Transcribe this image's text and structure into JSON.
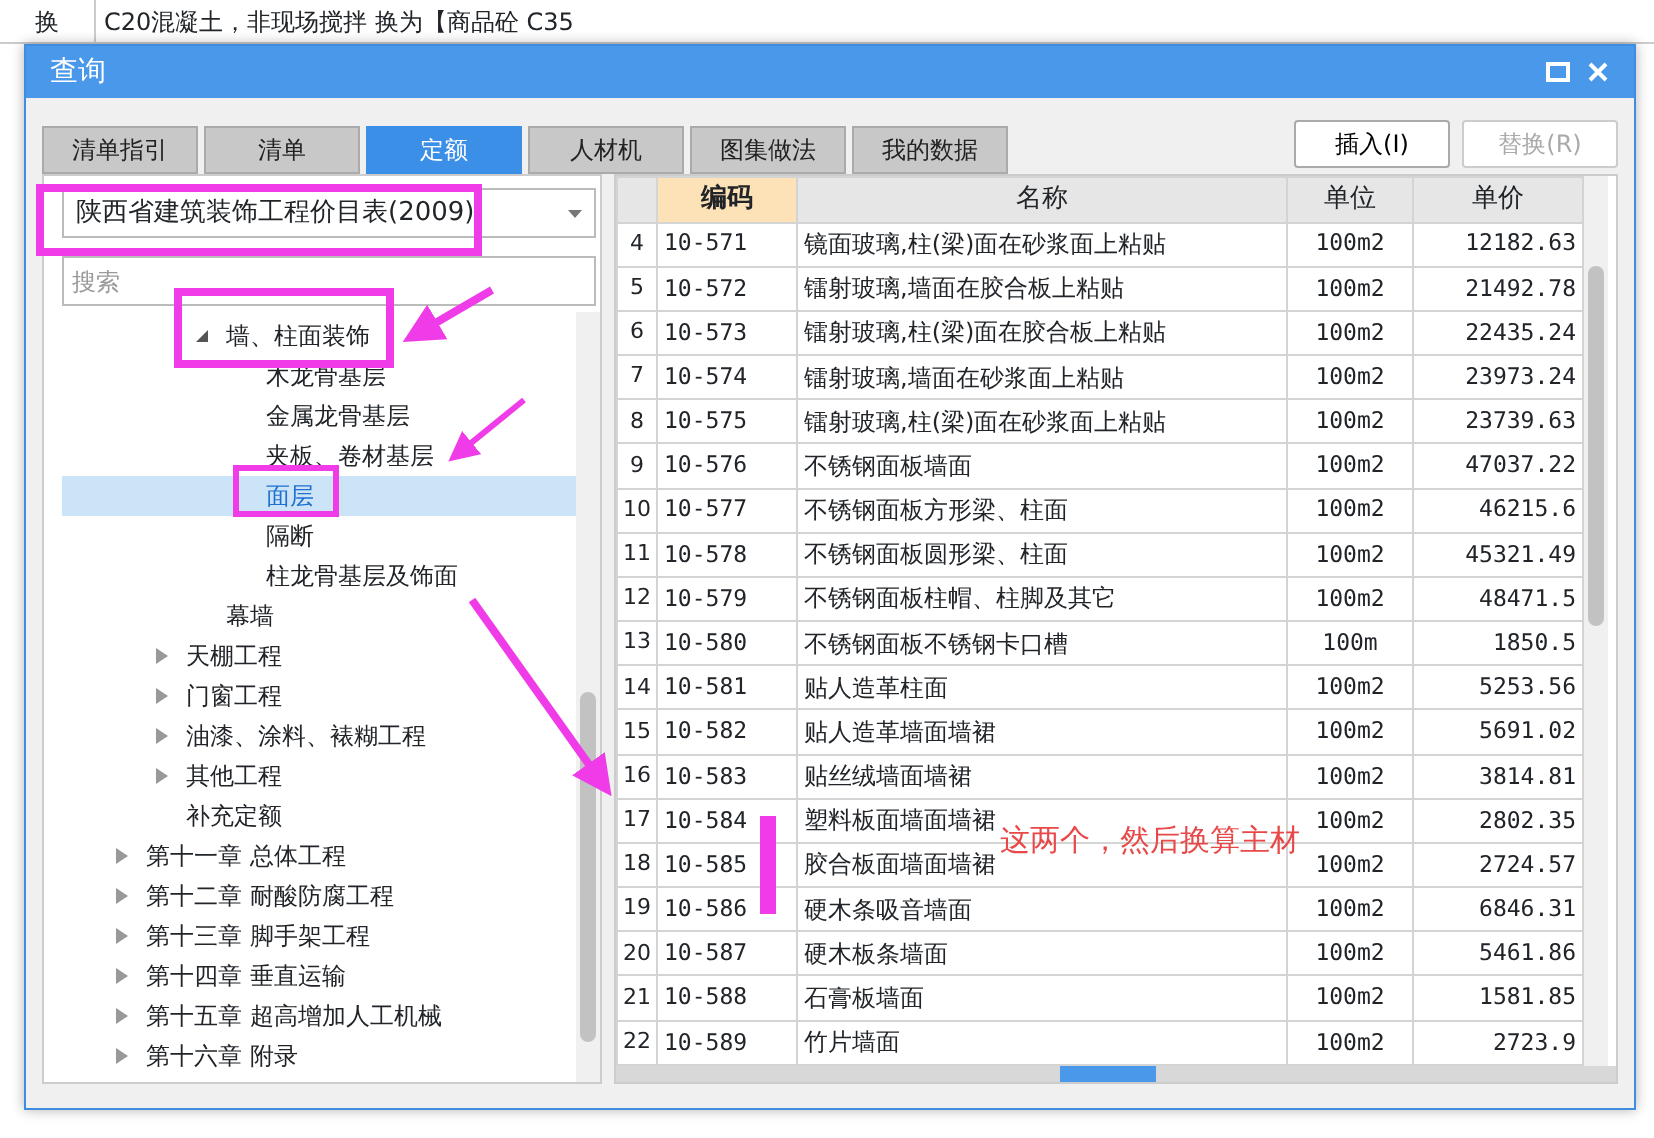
{
  "background": {
    "row": {
      "mark": "换",
      "description": "C20混凝土，非现场搅拌  换为【商品砼 C35"
    }
  },
  "window": {
    "title": "查询"
  },
  "tabs": [
    {
      "label": "清单指引",
      "selected": false
    },
    {
      "label": "清单",
      "selected": false
    },
    {
      "label": "定额",
      "selected": true
    },
    {
      "label": "人材机",
      "selected": false
    },
    {
      "label": "图集做法",
      "selected": false
    },
    {
      "label": "我的数据",
      "selected": false
    }
  ],
  "buttons": [
    {
      "label": "插入(I)",
      "disabled": false
    },
    {
      "label": "替换(R)",
      "disabled": true
    }
  ],
  "library_select": {
    "value": "陕西省建筑装饰工程价目表(2009)"
  },
  "search": {
    "placeholder": "搜索"
  },
  "tree": [
    {
      "children": [
        {
          "children": [
            {
              "label": "墙、柱面装饰",
              "expanded": true,
              "selected": false,
              "children": [
                {
                  "label": "木龙骨基层",
                  "selected": false
                },
                {
                  "label": "金属龙骨基层",
                  "selected": false
                },
                {
                  "label": "夹板、卷材基层",
                  "selected": false
                },
                {
                  "label": "面层",
                  "selected": true
                },
                {
                  "label": "隔断",
                  "selected": false
                },
                {
                  "label": "柱龙骨基层及饰面",
                  "selected": false
                }
              ]
            },
            {
              "label": "幕墙",
              "selected": false
            }
          ]
        },
        {
          "label": "天棚工程",
          "expanded": false,
          "selected": false
        },
        {
          "label": "门窗工程",
          "expanded": false,
          "selected": false
        },
        {
          "label": "油漆、涂料、裱糊工程",
          "expanded": false,
          "selected": false
        },
        {
          "label": "其他工程",
          "expanded": false,
          "selected": false
        },
        {
          "label": "补充定额",
          "selected": false
        }
      ]
    },
    {
      "label": "第十一章 总体工程",
      "expanded": false,
      "selected": false
    },
    {
      "label": "第十二章 耐酸防腐工程",
      "expanded": false,
      "selected": false
    },
    {
      "label": "第十三章 脚手架工程",
      "expanded": false,
      "selected": false
    },
    {
      "label": "第十四章 垂直运输",
      "expanded": false,
      "selected": false
    },
    {
      "label": "第十五章 超高增加人工机械",
      "expanded": false,
      "selected": false
    },
    {
      "label": "第十六章 附录",
      "expanded": false,
      "selected": false
    }
  ],
  "table": {
    "columns": [
      {
        "label": "编码",
        "selected": true
      },
      {
        "label": "名称",
        "selected": false
      },
      {
        "label": "单位",
        "selected": false
      },
      {
        "label": "单价",
        "selected": false
      }
    ],
    "rows": [
      {
        "index": "4",
        "code": "10-571",
        "name": "镜面玻璃,柱(梁)面在砂浆面上粘贴",
        "unit": "100m2",
        "price": "12182.63"
      },
      {
        "index": "5",
        "code": "10-572",
        "name": "镭射玻璃,墙面在胶合板上粘贴",
        "unit": "100m2",
        "price": "21492.78"
      },
      {
        "index": "6",
        "code": "10-573",
        "name": "镭射玻璃,柱(梁)面在胶合板上粘贴",
        "unit": "100m2",
        "price": "22435.24"
      },
      {
        "index": "7",
        "code": "10-574",
        "name": "镭射玻璃,墙面在砂浆面上粘贴",
        "unit": "100m2",
        "price": "23973.24"
      },
      {
        "index": "8",
        "code": "10-575",
        "name": "镭射玻璃,柱(梁)面在砂浆面上粘贴",
        "unit": "100m2",
        "price": "23739.63"
      },
      {
        "index": "9",
        "code": "10-576",
        "name": "不锈钢面板墙面",
        "unit": "100m2",
        "price": "47037.22"
      },
      {
        "index": "10",
        "code": "10-577",
        "name": "不锈钢面板方形梁、柱面",
        "unit": "100m2",
        "price": "46215.6"
      },
      {
        "index": "11",
        "code": "10-578",
        "name": "不锈钢面板圆形梁、柱面",
        "unit": "100m2",
        "price": "45321.49"
      },
      {
        "index": "12",
        "code": "10-579",
        "name": "不锈钢面板柱帽、柱脚及其它",
        "unit": "100m2",
        "price": "48471.5"
      },
      {
        "index": "13",
        "code": "10-580",
        "name": "不锈钢面板不锈钢卡口槽",
        "unit": "100m",
        "price": "1850.5"
      },
      {
        "index": "14",
        "code": "10-581",
        "name": "贴人造革柱面",
        "unit": "100m2",
        "price": "5253.56"
      },
      {
        "index": "15",
        "code": "10-582",
        "name": "贴人造革墙面墙裙",
        "unit": "100m2",
        "price": "5691.02"
      },
      {
        "index": "16",
        "code": "10-583",
        "name": "贴丝绒墙面墙裙",
        "unit": "100m2",
        "price": "3814.81"
      },
      {
        "index": "17",
        "code": "10-584",
        "name": "塑料板面墙面墙裙",
        "unit": "100m2",
        "price": "2802.35"
      },
      {
        "index": "18",
        "code": "10-585",
        "name": "胶合板面墙面墙裙",
        "unit": "100m2",
        "price": "2724.57"
      },
      {
        "index": "19",
        "code": "10-586",
        "name": "硬木条吸音墙面",
        "unit": "100m2",
        "price": "6846.31"
      },
      {
        "index": "20",
        "code": "10-587",
        "name": "硬木板条墙面",
        "unit": "100m2",
        "price": "5461.86"
      },
      {
        "index": "21",
        "code": "10-588",
        "name": "石膏板墙面",
        "unit": "100m2",
        "price": "1581.85"
      },
      {
        "index": "22",
        "code": "10-589",
        "name": "竹片墙面",
        "unit": "100m2",
        "price": "2723.9"
      }
    ]
  },
  "annotation": {
    "note": "这两个，然后换算主材"
  }
}
